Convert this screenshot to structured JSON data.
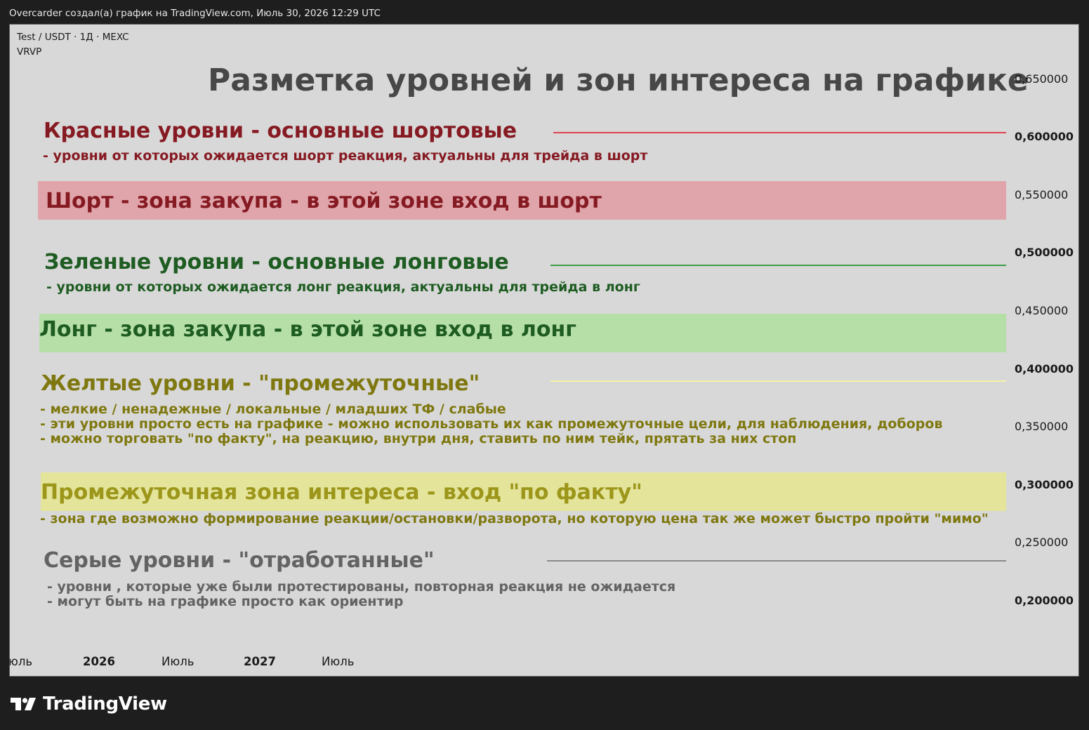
{
  "header": {
    "caption": "Overcarder создал(а) график на TradingView.com, Июль 30, 2026 12:29 UTC"
  },
  "chart": {
    "symbol_line": "Test / USDT · 1Д · MEXC",
    "indicator": "VRVP",
    "title": "Разметка уровней и зон интереса на графике"
  },
  "legend": {
    "red_title": "Красные уровни - основные шортовые",
    "red_desc": "- уровни от которых ожидается шорт реакция, актуальны для трейда в шорт",
    "short_zone": "Шорт - зона закупа - в этой зоне вход в шорт",
    "green_title": "Зеленые уровни - основные лонговые",
    "green_desc": "- уровни от которых ожидается лонг реакция, актуальны для трейда в лонг",
    "long_zone": "Лонг - зона закупа - в этой зоне вход в лонг",
    "yellow_title": "Желтые уровни - \"промежуточные\"",
    "yellow_desc": [
      "- мелкие / ненадежные / локальные / младших ТФ / слабые",
      "- эти уровни просто есть на графике - можно использовать их как промежуточные цели, для  наблюдения, доборов",
      "- можно торговать \"по факту\", на реакцию, внутри дня, ставить по ним тейк, прятать за них стоп"
    ],
    "mid_zone": "Промежуточная зона интереса - вход \"по факту\"",
    "mid_zone_desc": "- зона где возможно формирование реакции/остановки/разворота, но которую цена так же может быстро пройти \"мимо\"",
    "gray_title": "Серые уровни - \"отработанные\"",
    "gray_desc": [
      "- уровни , которые уже были протестированы, повторная реакция не ожидается",
      "- могут быть на графике просто как ориентир"
    ]
  },
  "price_axis": [
    "0,650000",
    "0,600000",
    "0,550000",
    "0,500000",
    "0,450000",
    "0,400000",
    "0,350000",
    "0,300000",
    "0,250000",
    "0,200000"
  ],
  "time_axis": [
    "юль",
    "2026",
    "Июль",
    "2027",
    "Июль"
  ],
  "footer": {
    "brand": "TradingView"
  },
  "colors": {
    "red_level": "#e0414e",
    "green_level": "#3d9c46",
    "yellow_level": "#f6f2a6",
    "gray_level": "#8a8a8a",
    "short_zone_fill": "#e0a5ab",
    "long_zone_fill": "#b5dfa7",
    "mid_zone_fill": "#e4e49b",
    "chart_bg": "#d8d8d8"
  }
}
